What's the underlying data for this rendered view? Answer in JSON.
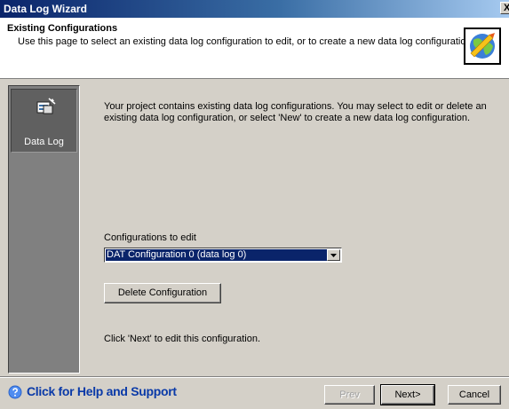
{
  "window": {
    "title": "Data Log Wizard",
    "close_label": "X"
  },
  "header": {
    "title": "Existing Configurations",
    "description": "Use this page to select an existing data log configuration to edit, or to create a new data log configuration."
  },
  "sidebar": {
    "items": [
      {
        "label": "Data Log"
      }
    ]
  },
  "main": {
    "intro": "Your project contains existing data log configurations. You may select to edit or delete an existing data log configuration, or select 'New' to create a new data log configuration.",
    "configs_label": "Configurations to edit",
    "selected_config": "DAT Configuration 0 (data log 0)",
    "delete_label": "Delete Configuration",
    "hint": "Click 'Next' to edit this configuration."
  },
  "footer": {
    "help_label": "Click for Help and Support",
    "prev_label": "Prev",
    "next_label": "Next>",
    "cancel_label": "Cancel"
  },
  "colors": {
    "accent": "#0a246a",
    "help_link": "#0a3aa8",
    "sidebar_bg": "#808080"
  },
  "icons": [
    "wizard-globe-icon",
    "data-log-icon",
    "dropdown-arrow-icon",
    "help-icon"
  ]
}
